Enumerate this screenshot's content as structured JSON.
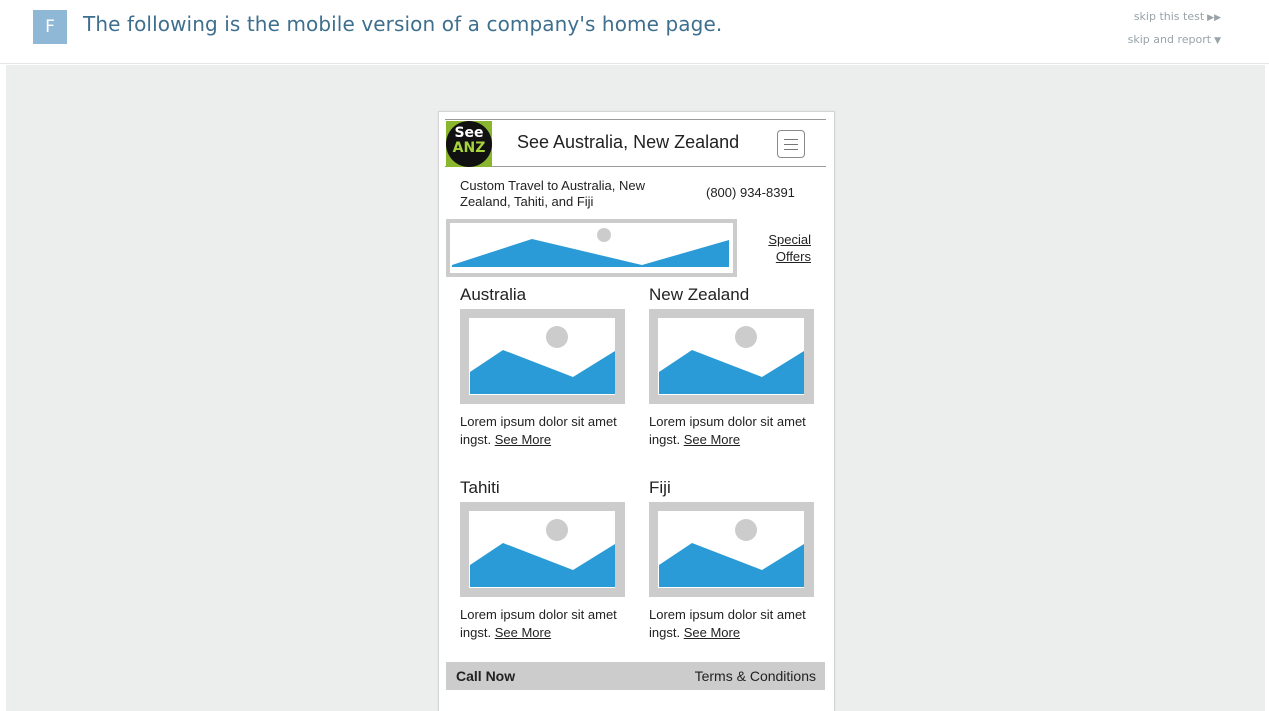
{
  "header": {
    "badge_letter": "F",
    "instruction": "The following is the mobile version of a company's home page.",
    "skip_test": "skip this test",
    "skip_report": "skip and report"
  },
  "mockup": {
    "logo": {
      "line1": "See",
      "line2": "ANZ"
    },
    "site_title": "See Australia, New Zealand",
    "tagline": "Custom Travel to Australia, New Zealand, Tahiti, and Fiji",
    "phone": "(800) 934-8391",
    "special_offers": "Special Offers",
    "destinations": [
      {
        "title": "Australia",
        "text": "Lorem ipsum dolor sit amet ingst.",
        "link": "See More"
      },
      {
        "title": "New Zealand",
        "text": "Lorem ipsum dolor sit amet ingst.",
        "link": "See More"
      },
      {
        "title": "Tahiti",
        "text": "Lorem ipsum dolor sit amet ingst.",
        "link": "See More"
      },
      {
        "title": "Fiji",
        "text": "Lorem ipsum dolor sit amet ingst.",
        "link": "See More"
      }
    ],
    "footer": {
      "call_now": "Call Now",
      "terms": "Terms & Conditions"
    }
  },
  "colors": {
    "instruction_text": "#3f6f8f",
    "badge": "#8fb8d6",
    "placeholder_gray": "#cccccc",
    "mountain_blue": "#2a9bd6",
    "logo_green": "#8ab52e"
  }
}
